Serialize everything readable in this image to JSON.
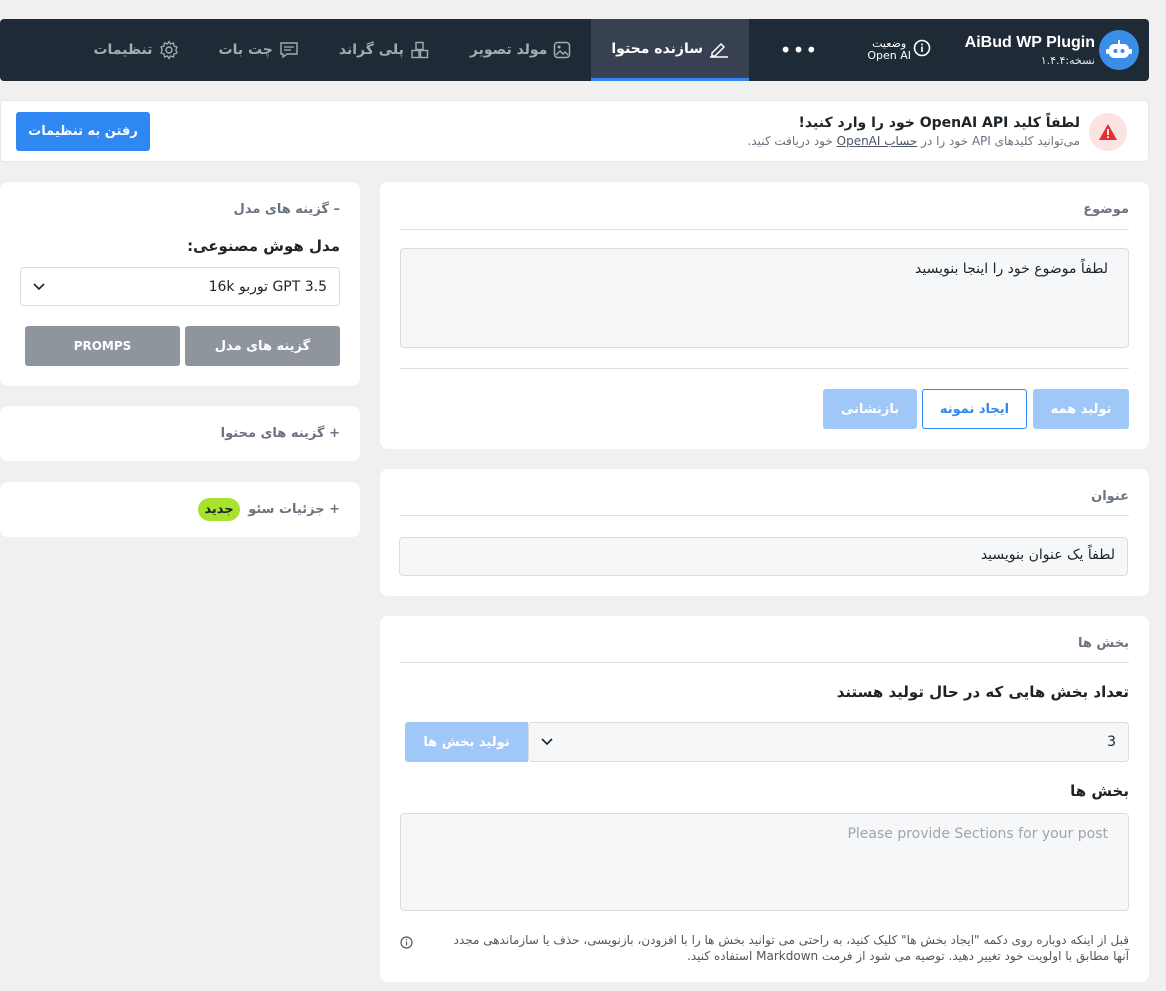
{
  "header": {
    "brand_title": "AiBud WP Plugin",
    "brand_version": "نسخه:۱.۴.۴",
    "status_line1": "وضعیت",
    "status_line2": "Open AI",
    "more": "•••",
    "tabs": [
      {
        "label": "سازنده محتوا",
        "icon": "pen-icon",
        "active": true
      },
      {
        "label": "مولد تصویر",
        "icon": "image-icon",
        "active": false
      },
      {
        "label": "پلی گراند",
        "icon": "cubes-icon",
        "active": false
      },
      {
        "label": "چت بات",
        "icon": "chat-icon",
        "active": false
      },
      {
        "label": "تنظیمات",
        "icon": "gear-icon",
        "active": false
      }
    ]
  },
  "notice": {
    "title": "لطفاً کلید OpenAI API خود را وارد کنید!",
    "sub_before": "می‌توانید کلیدهای API خود را در ",
    "sub_link": "حساب OpenAI",
    "sub_after": " خود دریافت کنید.",
    "button": "رفتن به تنظیمات",
    "icon": "warning-icon",
    "icon_color": "#e03131"
  },
  "topic": {
    "title": "موضوع",
    "placeholder": "لطفاً موضوع خود را اینجا بنویسید",
    "btn_generate_all": "تولید همه",
    "btn_example": "ایجاد نمونه",
    "btn_reset": "بازنشانی"
  },
  "title_card": {
    "title": "عنوان",
    "placeholder": "لطفاً یک عنوان بنویسید"
  },
  "sections": {
    "title": "بخش ها",
    "count_label": "تعداد بخش هایی که در حال تولید هستند",
    "count_value": "3",
    "btn_generate": "تولید بخش ها",
    "sections_label": "بخش ها",
    "sections_placeholder": "Please provide Sections for your post",
    "hint_line1": "قبل از اینکه دوباره روی دکمه \"ایجاد بخش ها\" کلیک کنید، به راحتی می توانید بخش ها را با افزودن، بازنویسی، حذف یا سازماندهی مجدد",
    "hint_line2": "آنها مطابق با اولویت خود تغییر دهید. توصیه می شود از فرمت Markdown استفاده کنید."
  },
  "sidebar": {
    "model_options_title": "– گزینه های مدل",
    "ai_model_label": "مدل هوش مصنوعی:",
    "ai_model_value": "GPT 3.5 توربو 16k",
    "btn_model_options": "گزینه های مدل",
    "btn_promps": "PROMPS",
    "content_options_title": "+ گزینه های محتوا",
    "seo_title": "+ جزئیات سئو",
    "seo_badge": "جدید"
  },
  "colors": {
    "primary": "#2f88f2",
    "nav_bg": "#1f2a37",
    "badge": "#a6e22e"
  }
}
